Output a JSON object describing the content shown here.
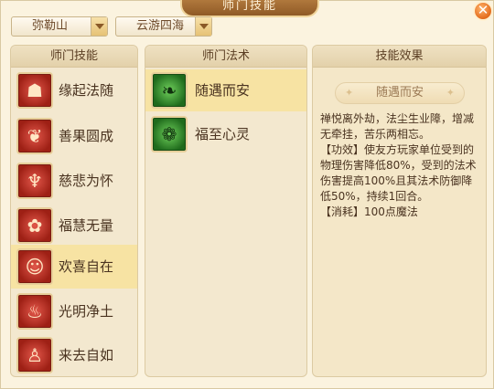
{
  "window": {
    "title": "师门技能"
  },
  "dropdowns": {
    "region": "弥勒山",
    "sect": "云游四海"
  },
  "panels": {
    "skills_header": "师门技能",
    "spells_header": "师门法术",
    "effect_header": "技能效果"
  },
  "skills": [
    {
      "label": "缘起法随",
      "icon": "monk-figure-icon"
    },
    {
      "label": "善果圆成",
      "icon": "fruit-icon"
    },
    {
      "label": "慈悲为怀",
      "icon": "praying-hands-icon"
    },
    {
      "label": "福慧无量",
      "icon": "lotus-icon"
    },
    {
      "label": "欢喜自在",
      "icon": "happy-monk-icon"
    },
    {
      "label": "光明净土",
      "icon": "flame-icon"
    },
    {
      "label": "来去自如",
      "icon": "meditation-icon"
    }
  ],
  "selected_skill": 4,
  "spells": [
    {
      "label": "随遇而安",
      "icon": "crow-icon"
    },
    {
      "label": "福至心灵",
      "icon": "butterfly-icon"
    }
  ],
  "selected_spell": 0,
  "effect": {
    "name": "随遇而安",
    "description": "禅悦离外劫，法尘生业障，增减无牵挂，苦乐两相忘。\n【功效】使友方玩家单位受到的物理伤害降低80%，受到的法术伤害提高100%且其法术防御降低50%，持续1回合。\n【消耗】100点魔法"
  },
  "colors": {
    "accent": "#8f5a26",
    "selected": "#f7e3a3",
    "panel_bg": "#f3e8cf",
    "close": "#e36c1d"
  }
}
